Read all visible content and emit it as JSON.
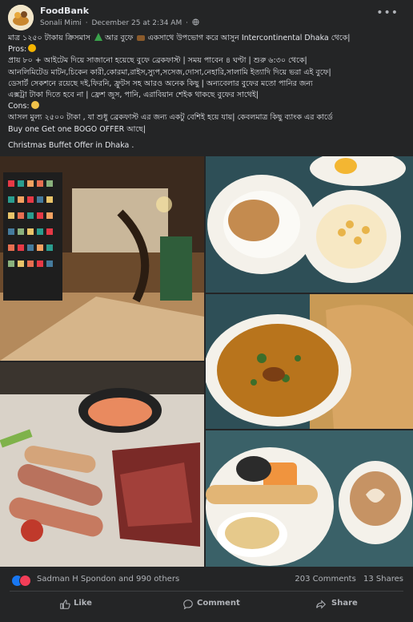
{
  "post": {
    "group_name": "FoodBank",
    "author": "Sonali Mimi",
    "separator": "·",
    "timestamp": "December 25 at 2:34 AM",
    "visibility_icon": "globe-icon",
    "more_label": "•••",
    "text_lines": [
      "মাত্র ১২৫০ টাকায় ক্রিসমাস",
      "আর বুফে",
      "একসাথে উপভোগ করে আসুন Intercontinental Dhaka থেকে|",
      "Pros:",
      "প্রায় ৮০ + আইটেম দিয়ে সাজানো হয়েছে বুফে ব্রেকফাস্ট | সময় পাবেন ৪ ঘণ্টা | শুরু ৬:৩০ থেকে|",
      "আনলিমিটেড মাটন,চিকেন কারী,কোরমা,রাইস,স্যুপ,সসেজ,দোসা,নেহারি,সালামি ইত্যাদি দিয়ে ভরা এই বুফে|",
      "ডেসার্ট সেকশনে রয়েছে দই,ফিরনি, ফ্রুটস সহ আরও অনেক কিছু | অন্যবেলার বুফের মতো পানির জন্য",
      "এক্সট্রা টাকা দিতে হবে না | ফ্রেশ জুস, পানি, এরাবিয়ান শেইক থাকছে বুফের সাথেই|",
      "Cons:",
      "আসল মুল্য ২৫০০ টাকা , যা শুধু ব্রেকফাস্ট এর জন্য একটু বেশিই হয়ে যায়| কেবলমাত্র কিছু ব্যাংক এর কার্ডে",
      "Buy one Get one BOGO OFFER আছে|",
      "Christmas Buffet Offer in Dhaka ."
    ]
  },
  "photos": [
    {
      "name": "hotel-lobby-photo",
      "icon": "lobby-image"
    },
    {
      "name": "cereal-nuts-photo",
      "icon": "breakfast-image"
    },
    {
      "name": "nihari-paratha-photo",
      "icon": "curry-image"
    },
    {
      "name": "sausage-platter-photo",
      "icon": "platter-image"
    },
    {
      "name": "coffee-roll-photo",
      "icon": "coffee-image"
    }
  ],
  "reactions": {
    "icons": [
      "like-icon",
      "love-icon"
    ],
    "text": "Sadman H Spondon and 990 others",
    "comments": "203 Comments",
    "shares": "13 Shares"
  },
  "actions": {
    "like": "Like",
    "comment": "Comment",
    "share": "Share"
  },
  "colors": {
    "background": "#242526",
    "text": "#e4e6eb",
    "secondary_text": "#b0b3b8",
    "like_blue": "#1877f2",
    "love_red": "#f33e58"
  }
}
